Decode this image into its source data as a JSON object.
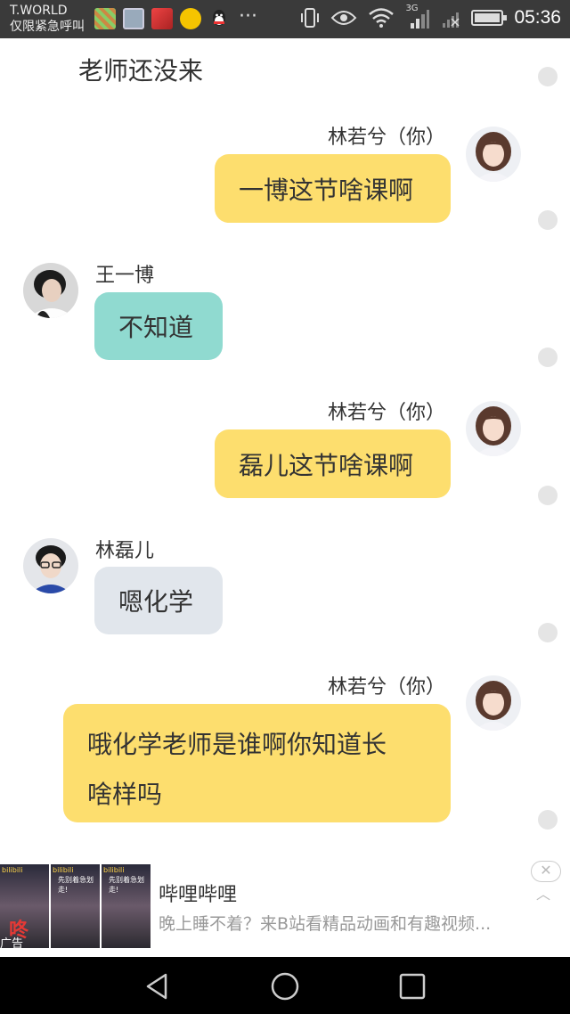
{
  "status_bar": {
    "carrier_line1": "T.WORLD",
    "carrier_line2": "仅限紧急呼叫",
    "more": "···",
    "network_label": "3G",
    "time": "05:36",
    "battery_level": 0.85
  },
  "page": {
    "title": "老师还没来"
  },
  "messages": [
    {
      "sender": "林若兮（你）",
      "text": "一博这节啥课啊",
      "side": "right",
      "bubble_color": "#FDDE6E",
      "avatar": "girl-avatar"
    },
    {
      "sender": "王一博",
      "text": "不知道",
      "side": "left",
      "bubble_color": "#90DAD0",
      "avatar": "boy-avatar-1"
    },
    {
      "sender": "林若兮（你）",
      "text": "磊儿这节啥课啊",
      "side": "right",
      "bubble_color": "#FDDE6E",
      "avatar": "girl-avatar"
    },
    {
      "sender": "林磊儿",
      "text": "嗯化学",
      "side": "left",
      "bubble_color": "#E1E6EC",
      "avatar": "boy-avatar-2"
    },
    {
      "sender": "林若兮（你）",
      "text_line1": "哦化学老师是谁啊你知道长",
      "text_line2": "啥样吗",
      "side": "right",
      "bubble_color": "#FDDE6E",
      "avatar": "girl-avatar"
    }
  ],
  "ad": {
    "title": "哔哩哔哩",
    "description": "晚上睡不着？来B站看精品动画和有趣视频...",
    "label": "广告",
    "thumb_tag": "bilibili",
    "thumb_text": "先别着急划走!",
    "thumb_big_char": "咚",
    "close_symbol": "✕"
  }
}
